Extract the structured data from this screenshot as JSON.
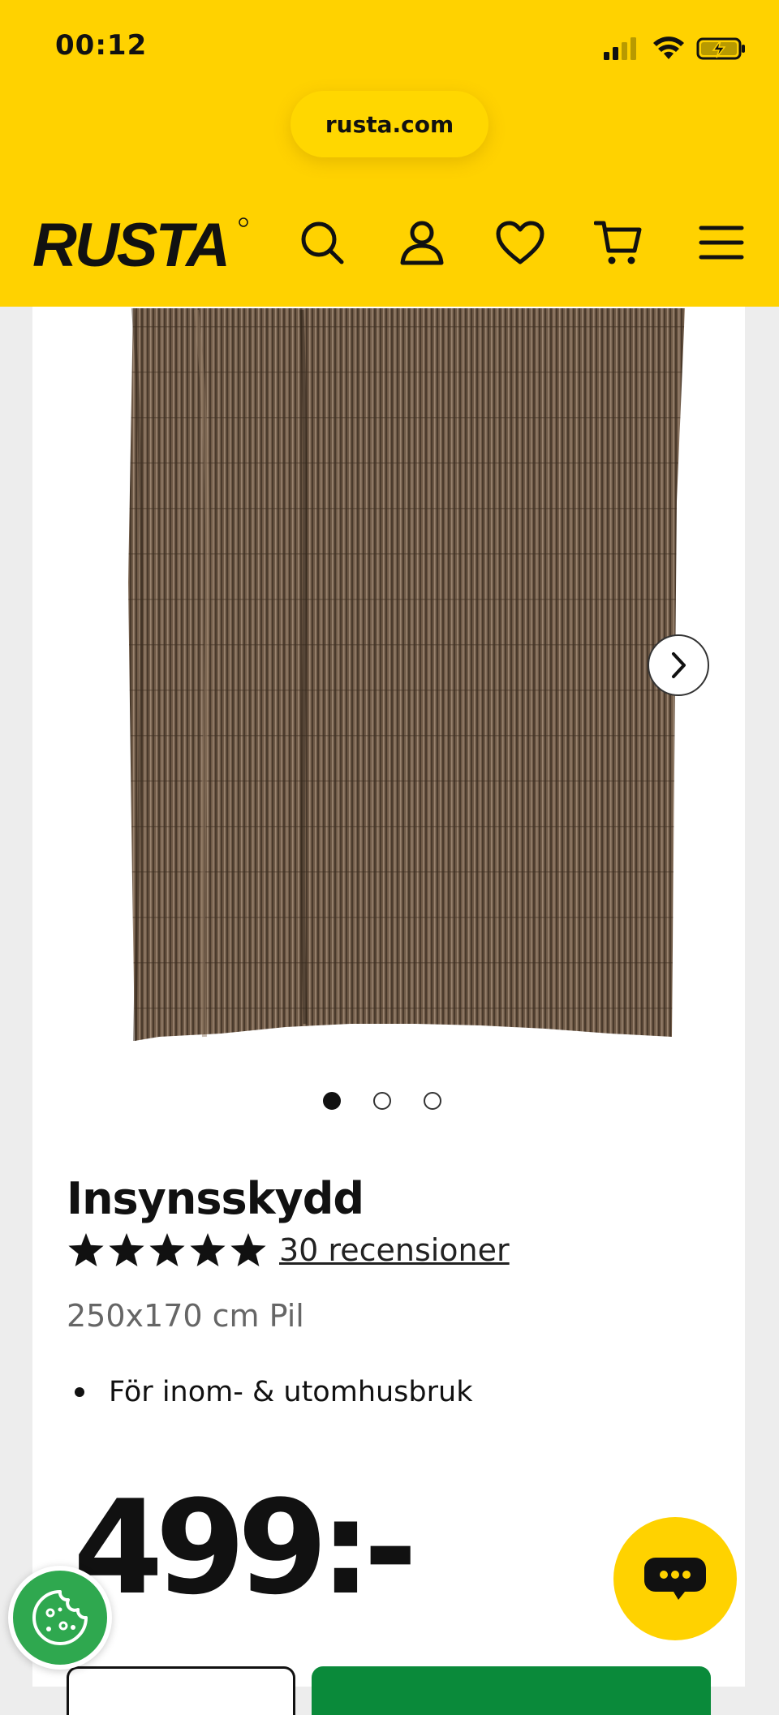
{
  "status_bar": {
    "time": "00:12"
  },
  "browser": {
    "url": "rusta.com"
  },
  "header": {
    "logo_text": "RUSTA",
    "icons": [
      "search-icon",
      "account-icon",
      "heart-icon",
      "cart-icon",
      "menu-icon"
    ]
  },
  "product": {
    "title": "Insynsskydd",
    "rating": 5,
    "reviews_label": "30 recensioner",
    "variant": "250x170 cm Pil",
    "features": [
      "För inom- & utomhusbruk"
    ],
    "price": "499:-",
    "image_count": 3,
    "active_image": 1
  },
  "colors": {
    "brand_yellow": "#ffd200",
    "buy_green": "#0a8a3a",
    "cookie_green": "#2fa84f"
  }
}
